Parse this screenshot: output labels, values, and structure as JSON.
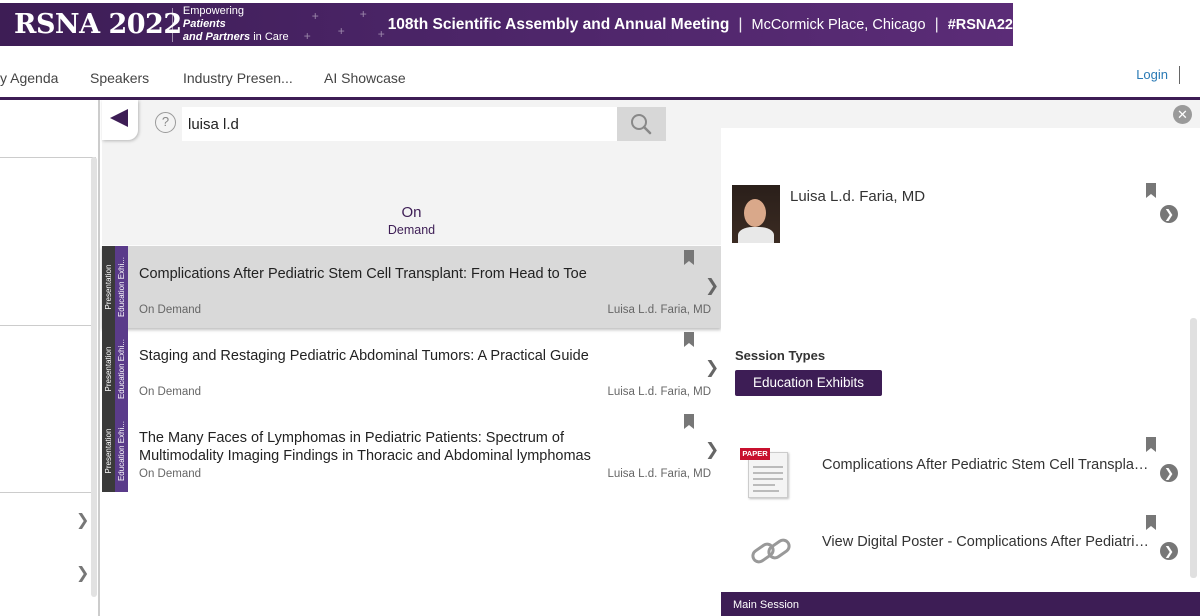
{
  "banner": {
    "logo": "RSNA 2022",
    "tagline_line1_plain": "Empowering ",
    "tagline_line1_bold": "Patients",
    "tagline_line2_bold": "and Partners",
    "tagline_line2_plain": " in Care",
    "meeting": "108th Scientific Assembly and Annual Meeting",
    "location": "McCormick Place, Chicago",
    "hashtag": "#RSNA22",
    "separator": "|",
    "colors": {
      "brand": "#3d1d55"
    }
  },
  "nav": {
    "items": [
      {
        "label": "y Agenda"
      },
      {
        "label": "Speakers"
      },
      {
        "label": "Industry Presen..."
      },
      {
        "label": "AI Showcase"
      }
    ],
    "login": "Login"
  },
  "search": {
    "value": "luisa l.d",
    "help_glyph": "?"
  },
  "filter": {
    "line1": "On",
    "line2": "Demand"
  },
  "results": [
    {
      "type": "Presentation",
      "category": "Education Exhi...",
      "title": "Complications After Pediatric Stem Cell Transplant: From Head to Toe",
      "status": "On Demand",
      "author": "Luisa L.d. Faria, MD",
      "selected": true
    },
    {
      "type": "Presentation",
      "category": "Education Exhi...",
      "title": "Staging and Restaging Pediatric Abdominal Tumors: A Practical Guide",
      "status": "On Demand",
      "author": "Luisa L.d. Faria, MD",
      "selected": false
    },
    {
      "type": "Presentation",
      "category": "Education Exhi...",
      "title": "The Many Faces of Lymphomas in Pediatric Patients: Spectrum of Multimodality Imaging Findings in Thoracic and Abdominal lymphomas",
      "status": "On Demand",
      "author": "Luisa L.d. Faria, MD",
      "selected": false
    }
  ],
  "detail": {
    "speaker": "Luisa L.d. Faria, MD",
    "session_types_label": "Session Types",
    "session_type": "Education Exhibits",
    "paper_badge": "PAPER",
    "documents": [
      {
        "icon": "paper-icon",
        "title": "Complications After Pediatric Stem Cell Transplant: From Head to Toe"
      },
      {
        "icon": "link-icon",
        "title": "View Digital Poster - Complications After Pediatric Stem Cell Transplant"
      }
    ],
    "footer": "Main Session"
  }
}
